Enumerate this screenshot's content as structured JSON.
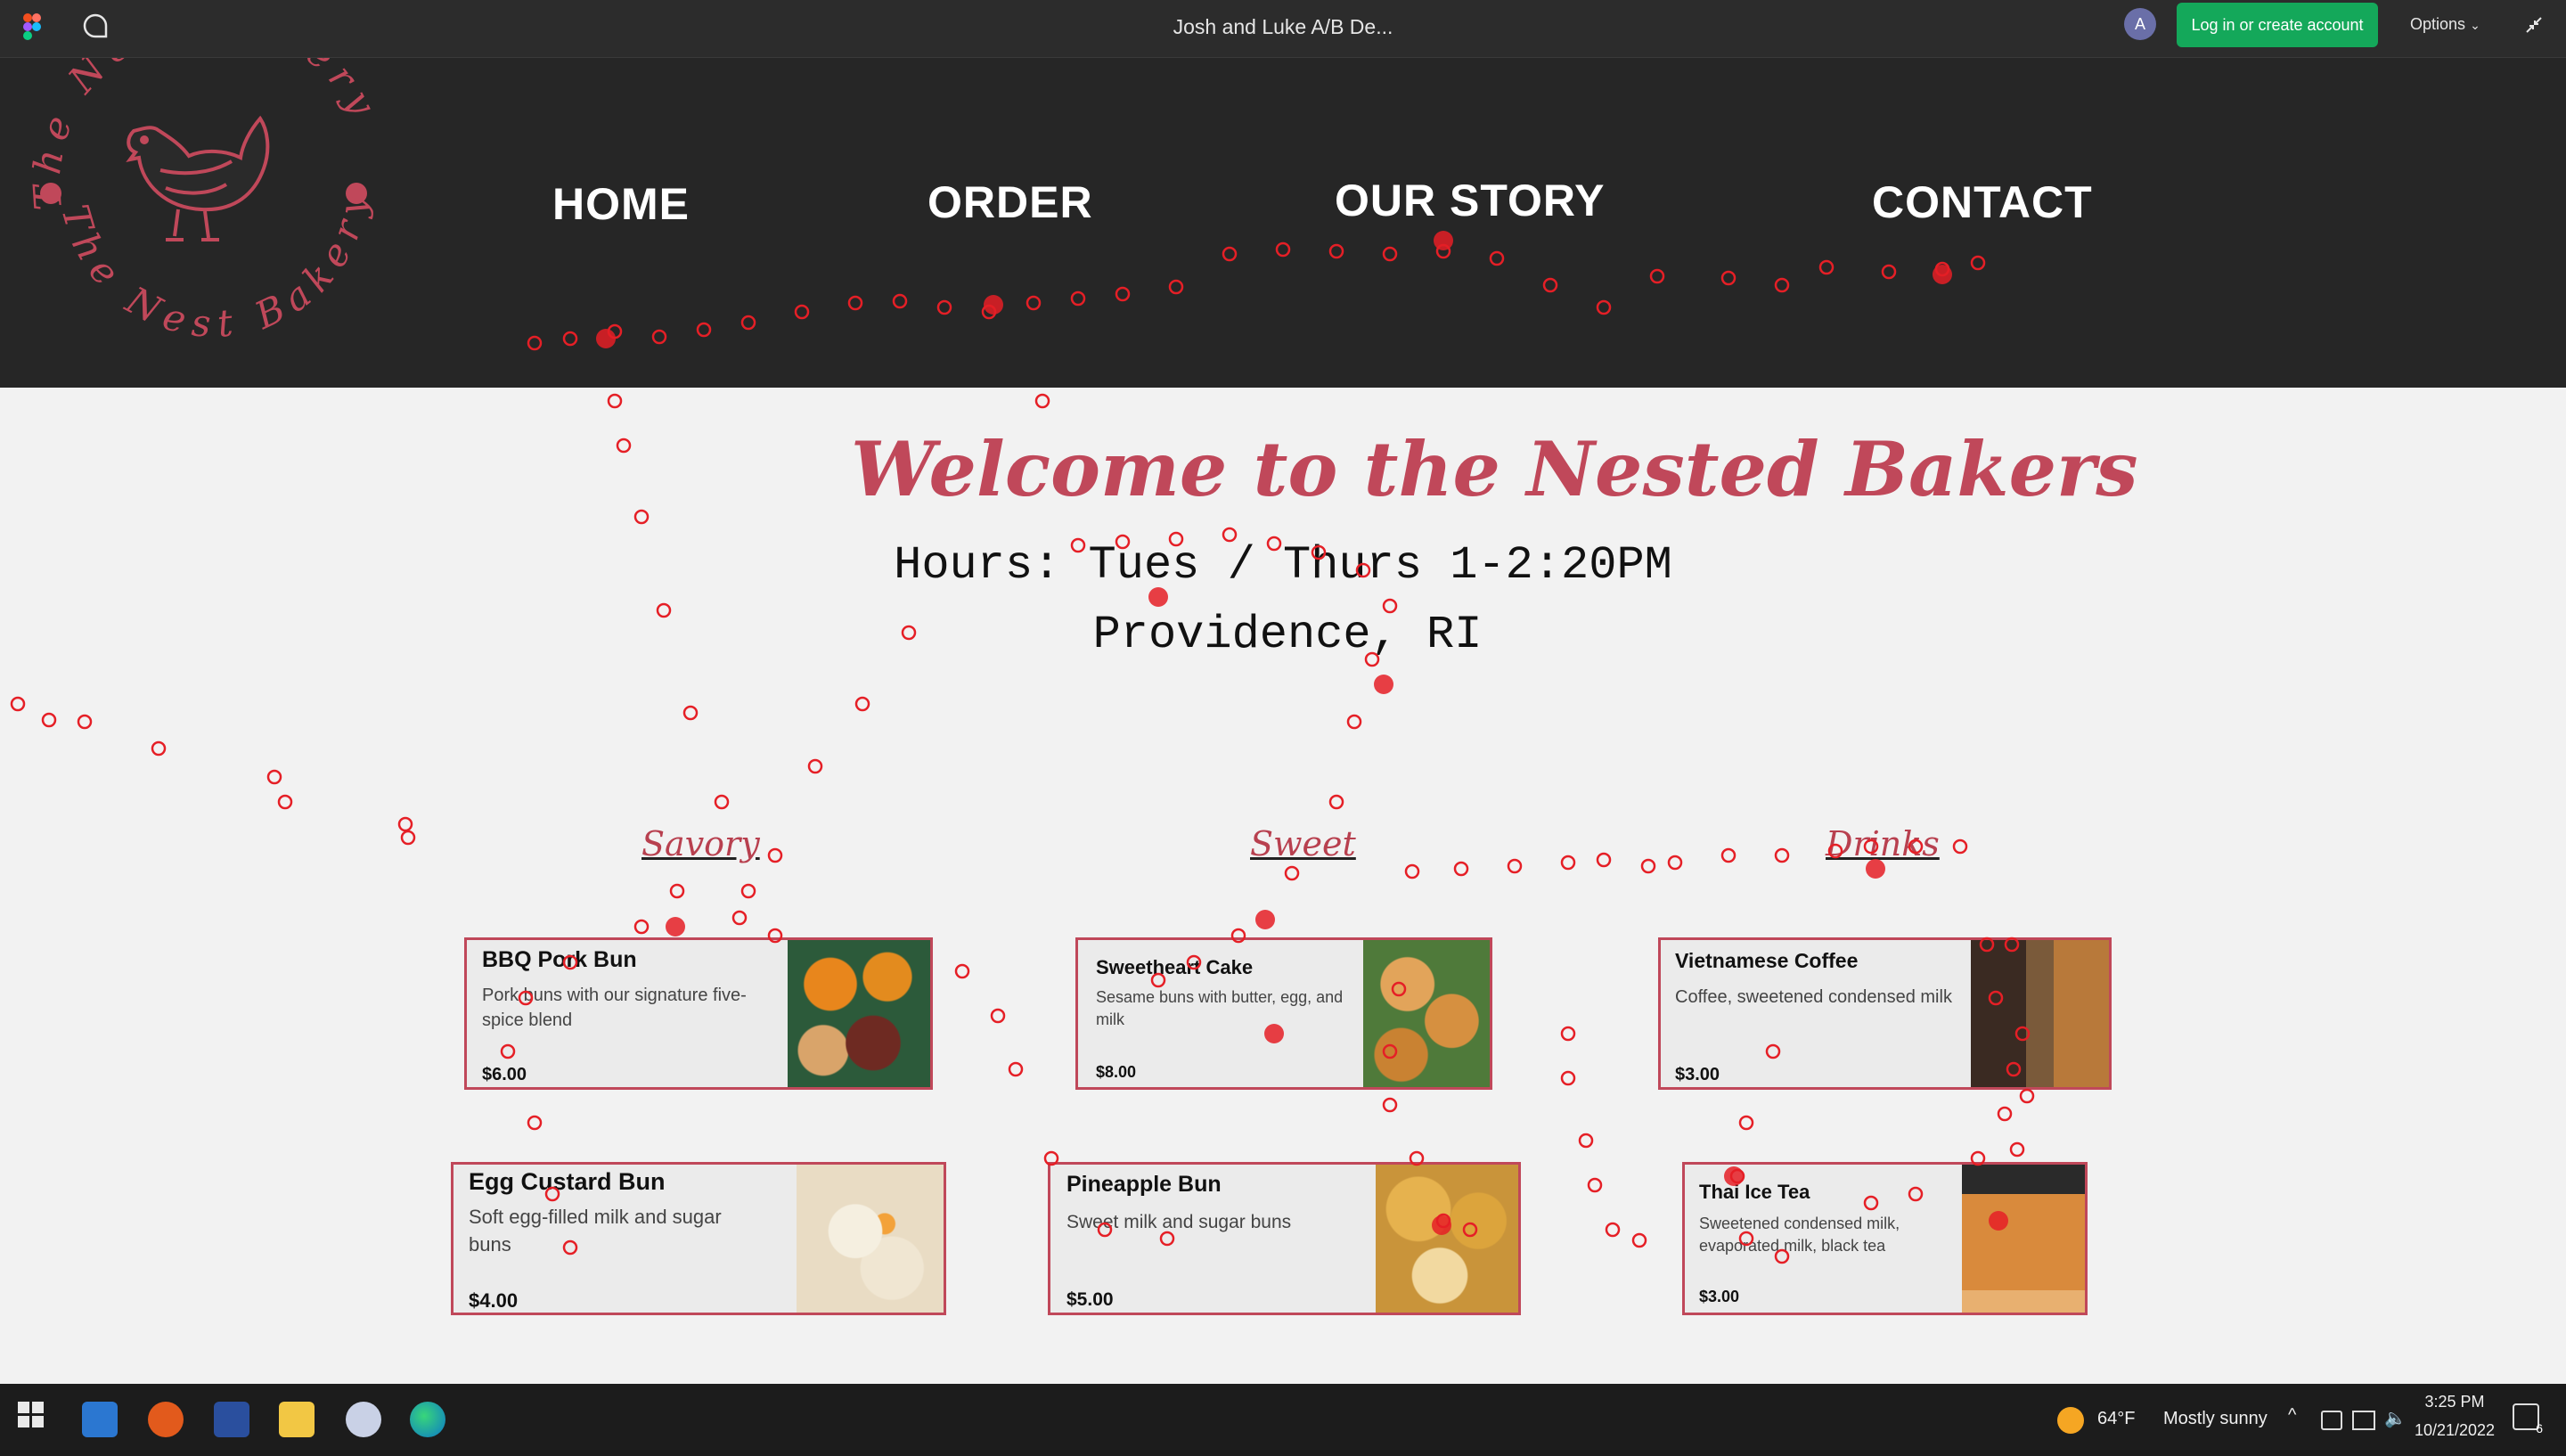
{
  "figma_bar": {
    "title": "Josh and Luke A/B De...",
    "avatar_letter": "A",
    "login_label": "Log in or create account",
    "options_label": "Options"
  },
  "logo": {
    "top_text": "The Nest Bakery",
    "bottom_text": "The Nest Bakery"
  },
  "nav": [
    {
      "label": "HOME"
    },
    {
      "label": "ORDER"
    },
    {
      "label": "OUR STORY"
    },
    {
      "label": "CONTACT"
    }
  ],
  "hero": {
    "title": "Welcome to the Nested Bakers",
    "hours": "Hours: Tues / Thurs 1-2:20PM",
    "location": "Providence, RI"
  },
  "categories": [
    {
      "label": "Savory"
    },
    {
      "label": "Sweet"
    },
    {
      "label": "Drinks"
    }
  ],
  "menu": [
    {
      "name": "BBQ Pork Bun",
      "desc": "Pork buns with our signature five-spice blend",
      "price": "$6.00"
    },
    {
      "name": "Egg Custard Bun",
      "desc": "Soft egg-filled milk and sugar buns",
      "price": "$4.00"
    },
    {
      "name": "Sweetheart Cake",
      "desc": "Sesame buns with butter, egg, and milk",
      "price": "$8.00"
    },
    {
      "name": "Pineapple Bun",
      "desc": "Sweet milk and sugar buns",
      "price": "$5.00"
    },
    {
      "name": "Vietnamese Coffee",
      "desc": "Coffee, sweetened condensed milk",
      "price": "$3.00"
    },
    {
      "name": "Thai Ice Tea",
      "desc": "Sweetened condensed milk, evaporated milk, black tea",
      "price": "$3.00"
    }
  ],
  "taskbar": {
    "temperature": "64°F",
    "weather": "Mostly sunny",
    "time": "3:25 PM",
    "date": "10/21/2022",
    "notification_count": "6"
  },
  "colors": {
    "accent": "#c0485a",
    "header_bg": "#262626",
    "login_green": "#14a85a",
    "heatmap_red": "#e51f26"
  },
  "heatmap_trail": {
    "description_visible": false
  }
}
